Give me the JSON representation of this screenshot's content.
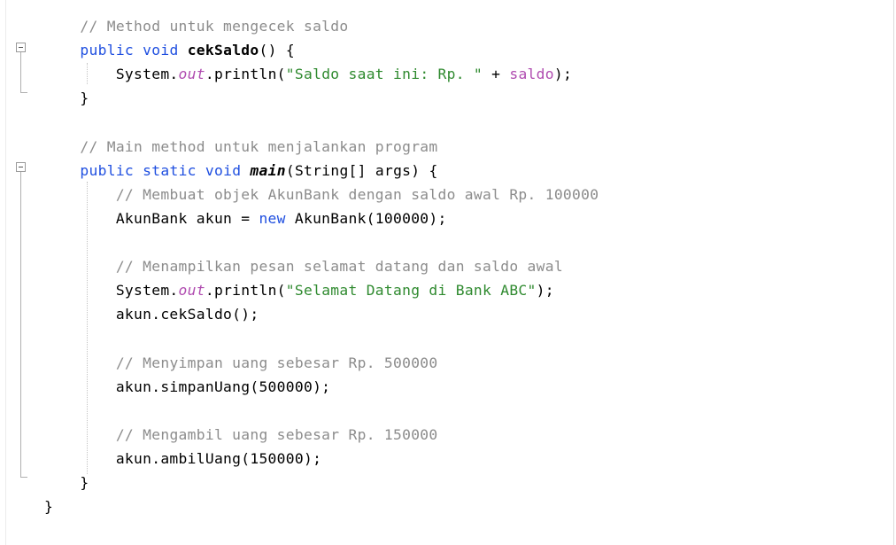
{
  "editor": {
    "lines": [
      [
        {
          "t": "    "
        },
        {
          "t": "// Method untuk mengecek saldo",
          "c": "cm"
        }
      ],
      [
        {
          "t": "    "
        },
        {
          "t": "public",
          "c": "kw"
        },
        {
          "t": " "
        },
        {
          "t": "void",
          "c": "kw"
        },
        {
          "t": " "
        },
        {
          "t": "cekSaldo",
          "c": "bold"
        },
        {
          "t": "() {"
        }
      ],
      [
        {
          "t": "        System."
        },
        {
          "t": "out",
          "c": "fld-it"
        },
        {
          "t": ".println("
        },
        {
          "t": "\"Saldo saat ini: Rp. \"",
          "c": "str"
        },
        {
          "t": " + "
        },
        {
          "t": "saldo",
          "c": "fld"
        },
        {
          "t": ");"
        }
      ],
      [
        {
          "t": "    }"
        }
      ],
      [],
      [
        {
          "t": "    "
        },
        {
          "t": "// Main method untuk menjalankan program",
          "c": "cm"
        }
      ],
      [
        {
          "t": "    "
        },
        {
          "t": "public",
          "c": "kw"
        },
        {
          "t": " "
        },
        {
          "t": "static",
          "c": "kw"
        },
        {
          "t": " "
        },
        {
          "t": "void",
          "c": "kw"
        },
        {
          "t": " "
        },
        {
          "t": "main",
          "c": "bold-it"
        },
        {
          "t": "(String[] args) {"
        }
      ],
      [
        {
          "t": "        "
        },
        {
          "t": "// Membuat objek AkunBank dengan saldo awal Rp. 100000",
          "c": "cm"
        }
      ],
      [
        {
          "t": "        AkunBank akun = "
        },
        {
          "t": "new",
          "c": "kw"
        },
        {
          "t": " AkunBank(100000);"
        }
      ],
      [],
      [
        {
          "t": "        "
        },
        {
          "t": "// Menampilkan pesan selamat datang dan saldo awal",
          "c": "cm"
        }
      ],
      [
        {
          "t": "        System."
        },
        {
          "t": "out",
          "c": "fld-it"
        },
        {
          "t": ".println("
        },
        {
          "t": "\"Selamat Datang di Bank ABC\"",
          "c": "str"
        },
        {
          "t": ");"
        }
      ],
      [
        {
          "t": "        akun.cekSaldo();"
        }
      ],
      [],
      [
        {
          "t": "        "
        },
        {
          "t": "// Menyimpan uang sebesar Rp. 500000",
          "c": "cm"
        }
      ],
      [
        {
          "t": "        akun.simpanUang(500000);"
        }
      ],
      [],
      [
        {
          "t": "        "
        },
        {
          "t": "// Mengambil uang sebesar Rp. 150000",
          "c": "cm"
        }
      ],
      [
        {
          "t": "        akun.ambilUang(150000);"
        }
      ],
      [
        {
          "t": "    }"
        }
      ],
      [
        {
          "t": "}"
        }
      ]
    ]
  },
  "fold_markers": [
    {
      "name": "fold-toggle-cekSaldo",
      "symbol": "minus"
    },
    {
      "name": "fold-toggle-main",
      "symbol": "minus"
    }
  ]
}
